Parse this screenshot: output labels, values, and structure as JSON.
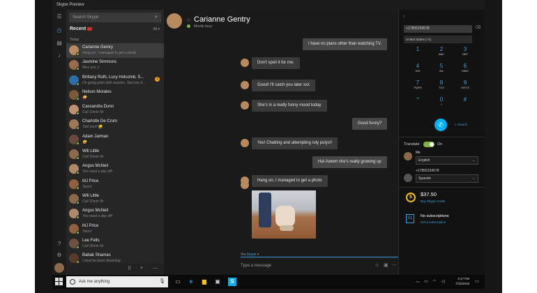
{
  "window": {
    "title": "Skype Preview"
  },
  "search": {
    "placeholder": "Search Skype"
  },
  "contacts": {
    "heading": "Recent",
    "filter": "All",
    "group": "Today",
    "items": [
      {
        "name": "Carianne Gentry",
        "mood": "Hang on, I managed to get a photo",
        "color": "#b88a5e"
      },
      {
        "name": "Jasmine Simmons",
        "mood": "Miss you ;)",
        "color": "#9a6a4a"
      },
      {
        "name": "Brittany Roth, Lucy Holcomb, S...",
        "mood": "I'm going plain with sequins. See you 9...",
        "color": "#2b6ea8",
        "badge": "2"
      },
      {
        "name": "Nelson Morales",
        "mood": "😜",
        "color": "#7a5a3a"
      },
      {
        "name": "Cassandra Dunn",
        "mood": "Call 10min 5h",
        "color": "#c09070"
      },
      {
        "name": "Charlotte De Crum",
        "mood": "Told you!! 😀",
        "color": "#a07858"
      },
      {
        "name": "Adam Jarman",
        "mood": "😀",
        "color": "#6a4a3a"
      },
      {
        "name": "Will Little",
        "mood": "Call 10min 5h",
        "color": "#8a6a4a"
      },
      {
        "name": "Angus McNeil",
        "mood": "You need a day off!",
        "color": "#b08868"
      },
      {
        "name": "MJ Price",
        "mood": "Twins!",
        "color": "#906040"
      },
      {
        "name": "Will Little",
        "mood": "Call 10min 5h",
        "color": "#8a6a4a"
      },
      {
        "name": "Angus McNeil",
        "mood": "You need a day off!",
        "color": "#b08868"
      },
      {
        "name": "MJ Price",
        "mood": "Twins!",
        "color": "#906040"
      },
      {
        "name": "Lee Felts",
        "mood": "Call 26min 5h",
        "color": "#705040"
      },
      {
        "name": "Babak Shamas",
        "mood": "I must've been dreaming",
        "color": "#5a3a2a"
      }
    ]
  },
  "chat": {
    "contact_name": "Carianne Gentry",
    "status": "Mostly busy",
    "messages": [
      {
        "text": "I have no plans other than watching TV.",
        "side": "right"
      },
      {
        "text": "Don't spoil it for me.",
        "side": "left"
      },
      {
        "text": "Good! I'll catch you later xxx",
        "side": "left"
      },
      {
        "text": "She's in a really funny mood today",
        "side": "left"
      },
      {
        "text": "Good funny?",
        "side": "right"
      },
      {
        "text": "Yes! Chatting and attempting roly polys!!",
        "side": "left"
      },
      {
        "text": "Ha! Awwm she's really growing up",
        "side": "right"
      },
      {
        "text": "Hang on, I managed to get a photo",
        "side": "left"
      }
    ],
    "via_prefix": "Via",
    "via_service": "Skype",
    "input_placeholder": "Type a message"
  },
  "dialer": {
    "number": "+17855234578",
    "country": "United States (+1)",
    "keys": [
      {
        "digit": "1",
        "letters": ""
      },
      {
        "digit": "2",
        "letters": "ABC"
      },
      {
        "digit": "3",
        "letters": "DEF"
      },
      {
        "digit": "4",
        "letters": "GHI"
      },
      {
        "digit": "5",
        "letters": "JKL"
      },
      {
        "digit": "6",
        "letters": "MNO"
      },
      {
        "digit": "7",
        "letters": "PQRS"
      },
      {
        "digit": "8",
        "letters": "TUV"
      },
      {
        "digit": "9",
        "letters": "WXYZ"
      },
      {
        "digit": "*",
        "letters": ""
      },
      {
        "digit": "0",
        "letters": "+"
      },
      {
        "digit": "#",
        "letters": ""
      }
    ],
    "search_label": "Search",
    "translate_label": "Translate",
    "translate_state": "On",
    "me_label": "Me",
    "me_language": "English",
    "other_label": "+17855234578",
    "other_language": "Spanish",
    "credit_amount": "$37.50",
    "credit_link": "Buy Skype Credit",
    "subscriptions_title": "No subscriptions",
    "subscriptions_link": "Get a subscription"
  },
  "taskbar": {
    "search_placeholder": "Ask me anything",
    "time": "3:17 PM",
    "date": "7/15/2016"
  },
  "colors": {
    "accent": "#00aff0",
    "presence": "#7cb342",
    "alert": "#d32f2f"
  }
}
